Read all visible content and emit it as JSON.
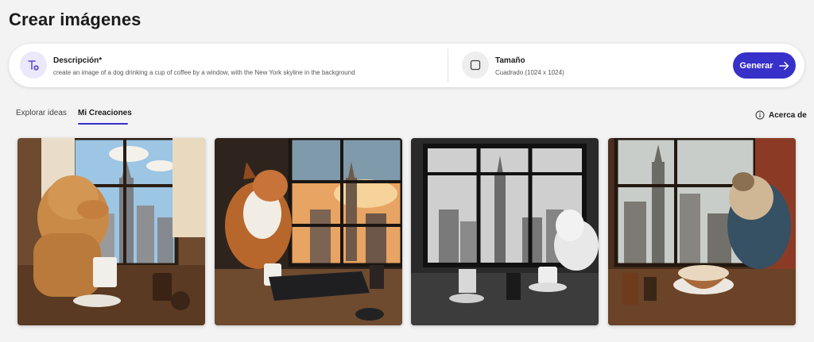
{
  "page": {
    "title": "Crear imágenes"
  },
  "prompt": {
    "description_label": "Descripción*",
    "description_value": "create an image of a dog drinking a cup of coffee by a window, with the New York skyline in the background",
    "description_icon": "text-sparkle-icon",
    "size_label": "Tamaño",
    "size_value": "Cuadrado (1024 x 1024)",
    "size_icon": "square-icon",
    "generate_label": "Generar",
    "generate_icon": "arrow-right-icon"
  },
  "tabs": [
    {
      "label": "Explorar ideas",
      "active": false
    },
    {
      "label": "Mi Creaciones",
      "active": true
    }
  ],
  "about": {
    "label": "Acerca de",
    "icon": "info-icon"
  },
  "gallery": {
    "items": [
      {
        "subject": "dog-coffee-window-color-1",
        "icon": "generated-image"
      },
      {
        "subject": "dog-coffee-keyboard-sunset",
        "icon": "generated-image"
      },
      {
        "subject": "dog-coffee-window-monochrome",
        "icon": "generated-image"
      },
      {
        "subject": "dog-latte-art-window",
        "icon": "generated-image"
      }
    ]
  },
  "colors": {
    "accent": "#3730c9",
    "background": "#f3f3f3",
    "icon_bg": "#ece8fb"
  }
}
